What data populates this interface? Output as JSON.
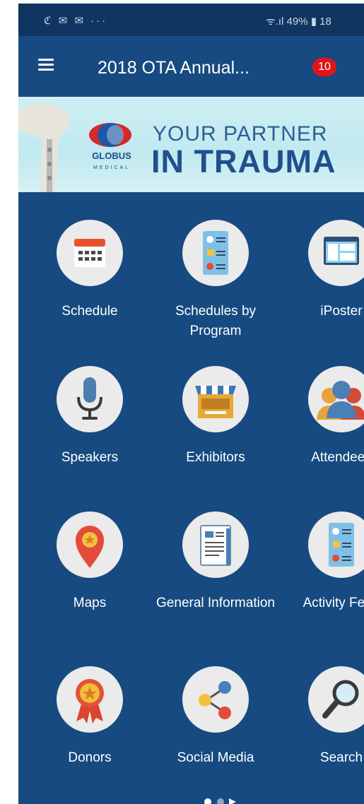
{
  "status_bar": {
    "left_icons": "ℭ ✉ ✉ ···",
    "right_text": "ᯤ.ıl 49% ▮ 18"
  },
  "app_bar": {
    "title": "2018 OTA Annual...",
    "badge_count": "10"
  },
  "banner": {
    "brand_name": "GLOBUS",
    "brand_sub": "MEDICAL",
    "line1": "YOUR PARTNER",
    "line2": "IN TRAUMA"
  },
  "menu": [
    {
      "label": "Schedule",
      "icon": "calendar-icon"
    },
    {
      "label": "Schedules by Program",
      "icon": "program-list-icon"
    },
    {
      "label": "iPoster",
      "icon": "poster-icon"
    },
    {
      "label": "Speakers",
      "icon": "microphone-icon"
    },
    {
      "label": "Exhibitors",
      "icon": "booth-icon"
    },
    {
      "label": "Attendees",
      "icon": "people-icon"
    },
    {
      "label": "Maps",
      "icon": "map-pin-icon"
    },
    {
      "label": "General Information",
      "icon": "document-icon"
    },
    {
      "label": "Activity Feed",
      "icon": "feed-list-icon"
    },
    {
      "label": "Donors",
      "icon": "award-ribbon-icon"
    },
    {
      "label": "Social Media",
      "icon": "share-icon"
    },
    {
      "label": "Search",
      "icon": "magnifier-icon"
    }
  ],
  "colors": {
    "background": "#174a80",
    "status_bar": "#0f3560",
    "badge": "#e0151c",
    "banner": "#c6ecf1"
  }
}
